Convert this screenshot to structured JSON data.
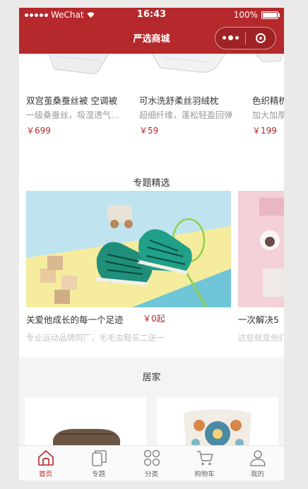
{
  "status_bar": {
    "carrier": "WeChat",
    "time": "16:43",
    "battery": "100%"
  },
  "nav": {
    "title": "严选商城"
  },
  "goods": [
    {
      "name": "双宫茧桑蚕丝被 空调被",
      "desc": "一级桑蚕丝，吸湿透气...",
      "price": "￥699"
    },
    {
      "name": "可水洗舒柔丝羽绒枕",
      "desc": "超细纤维，蓬松轻盈回弹",
      "price": "￥59"
    },
    {
      "name": "色织精梳",
      "desc": "加大加厚",
      "price": "￥199"
    }
  ],
  "topic_section": {
    "title": "专题精选",
    "items": [
      {
        "name": "关爱他成长的每一个足迹",
        "price": "￥0起",
        "desc": "专业运动品牌同厂，毛毛虫鞋买二送一"
      },
      {
        "name": "一次解决5",
        "desc": "这些就是他们"
      }
    ]
  },
  "home_section": {
    "title": "居家"
  },
  "tabbar": [
    {
      "label": "首页",
      "icon": "home-icon",
      "active": true
    },
    {
      "label": "专题",
      "icon": "topic-icon",
      "active": false
    },
    {
      "label": "分类",
      "icon": "category-icon",
      "active": false
    },
    {
      "label": "购物车",
      "icon": "cart-icon",
      "active": false
    },
    {
      "label": "我的",
      "icon": "profile-icon",
      "active": false
    }
  ],
  "colors": {
    "brand_red": "#b5282b",
    "price_red": "#b4282d"
  }
}
